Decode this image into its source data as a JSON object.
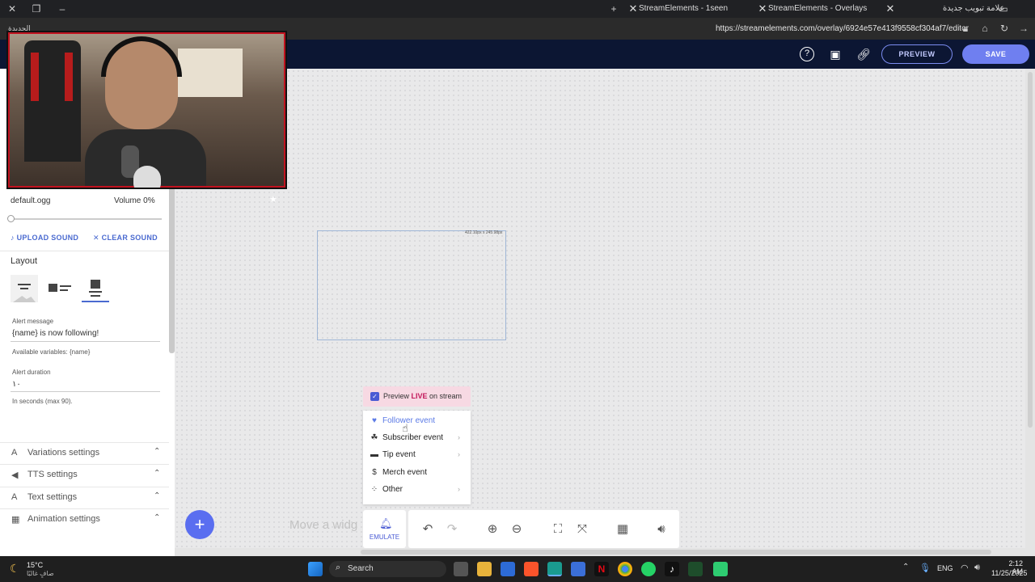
{
  "browser": {
    "tabs": [
      {
        "label": "StreamElements - 1seen"
      },
      {
        "label": "StreamElements - Overlays"
      },
      {
        "label": "علامة تبويب جديدة"
      }
    ],
    "url": "https://streamelements.com/overlay/6924e57e413f9558cf304af7/editor",
    "left_badge": "الجديدة"
  },
  "header": {
    "preview_label": "PREVIEW",
    "save_label": "SAVE"
  },
  "panel": {
    "sound_file": "default.ogg",
    "volume_label": "Volume 0%",
    "upload_sound": "UPLOAD SOUND",
    "clear_sound": "CLEAR SOUND",
    "layout_title": "Layout",
    "alert_message_label": "Alert message",
    "alert_message_value": "{name} is now following!",
    "available_variables": "Available variables: {name}",
    "alert_duration_label": "Alert duration",
    "alert_duration_value": "١٠",
    "duration_hint": "In seconds (max 90).",
    "sections": [
      {
        "label": "Variations settings",
        "icon": "variations-icon"
      },
      {
        "label": "TTS settings",
        "icon": "speaker-icon"
      },
      {
        "label": "Text settings",
        "icon": "text-icon"
      },
      {
        "label": "Animation settings",
        "icon": "animation-icon"
      }
    ]
  },
  "canvas": {
    "widget_size": "422.10px x 245.98px",
    "move_hint": "Move a widg"
  },
  "event_menu": {
    "preview_live_prefix": "Preview ",
    "preview_live_emph": "LIVE",
    "preview_live_suffix": " on stream",
    "items": [
      {
        "label": "Follower event",
        "icon": "heart-icon",
        "active": true
      },
      {
        "label": "Subscriber event",
        "icon": "subscriber-icon"
      },
      {
        "label": "Tip event",
        "icon": "card-icon"
      },
      {
        "label": "Merch event",
        "icon": "dollar-icon"
      },
      {
        "label": "Other",
        "icon": "other-icon"
      }
    ]
  },
  "toolbar": {
    "emulate_label": "EMULATE"
  },
  "taskbar": {
    "weather_temp": "15°C",
    "weather_desc": "صافٍ غالبًا",
    "search_label": "Search",
    "lang": "ENG",
    "time": "2:12 AM",
    "date": "11/25/2025"
  },
  "colors": {
    "accent": "#6f7ff0",
    "header_bg": "#0c1633",
    "live": "#c2185b"
  }
}
